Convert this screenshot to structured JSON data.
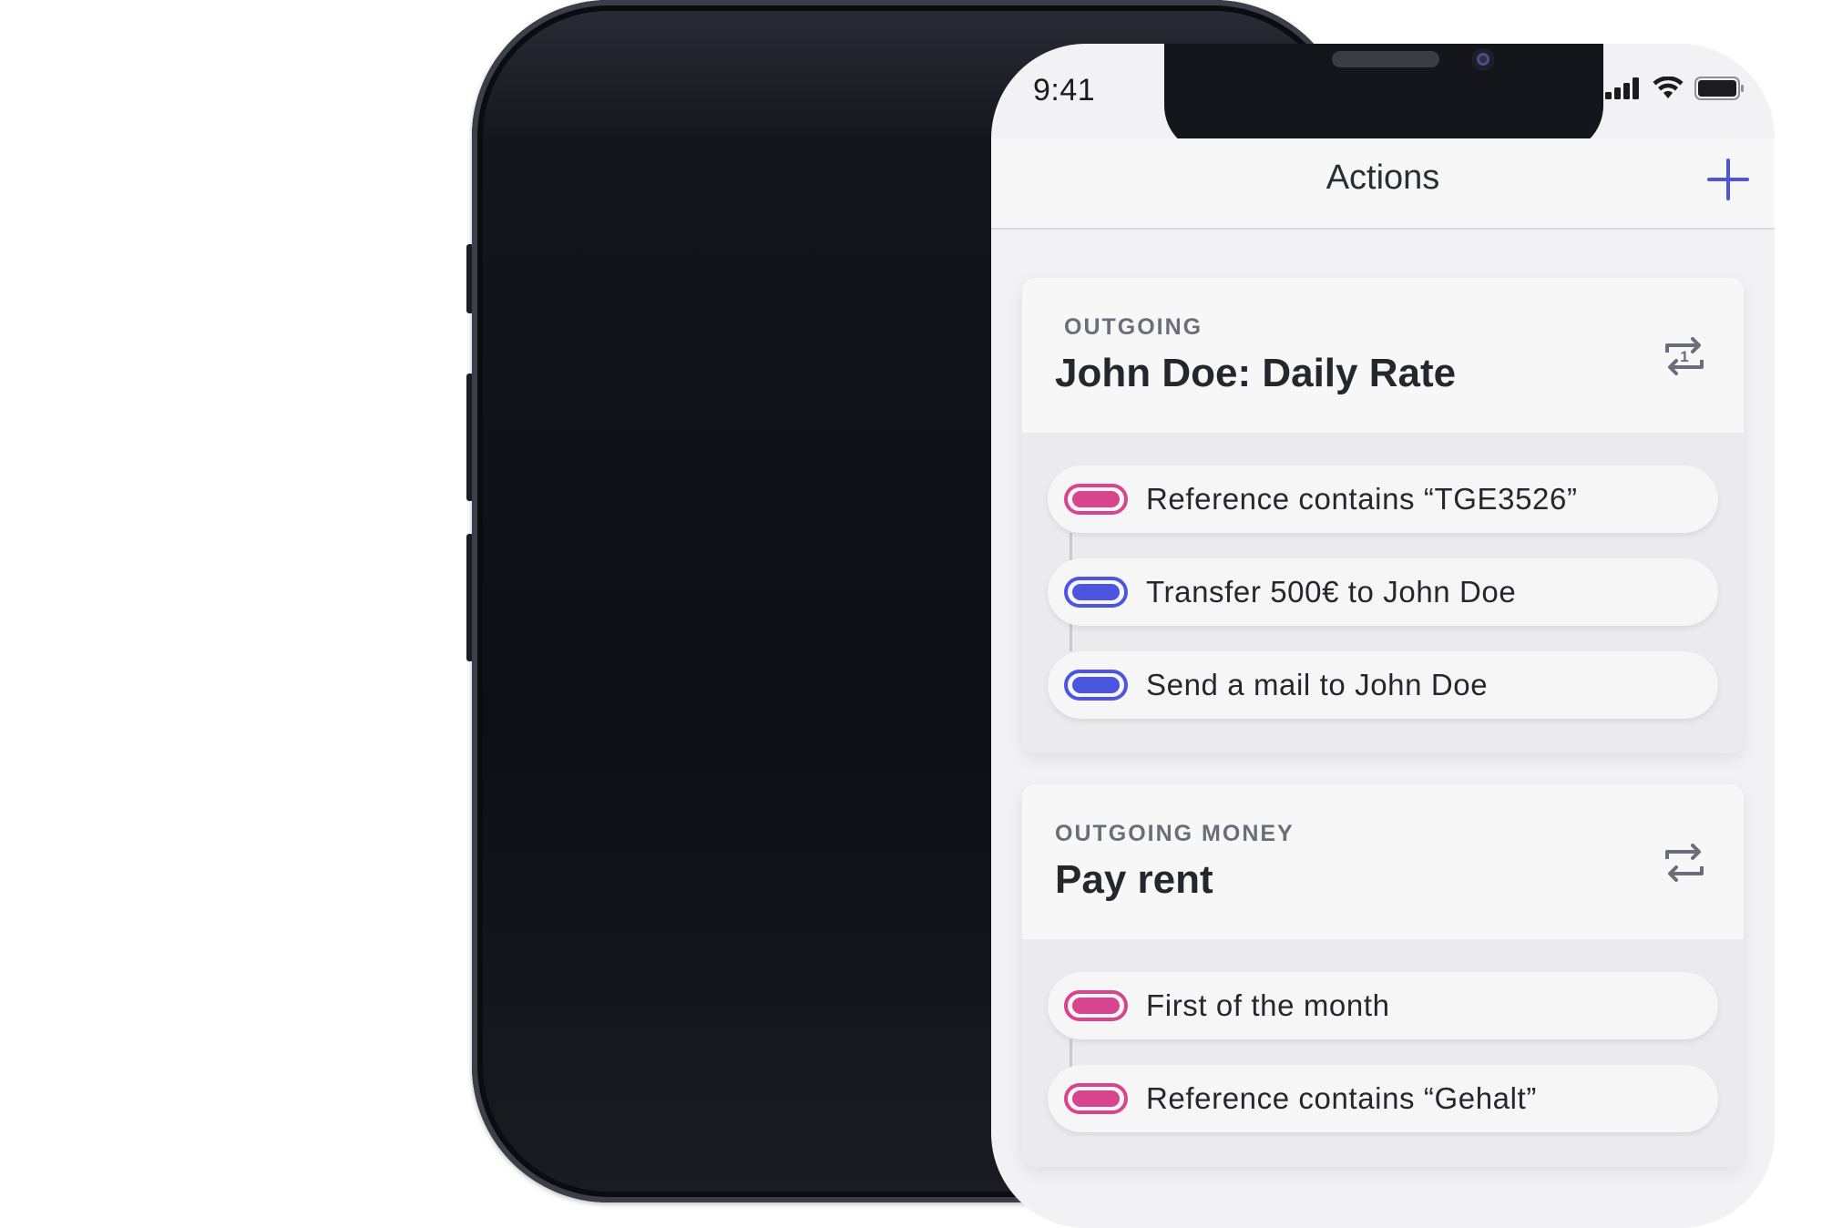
{
  "status_bar": {
    "time": "9:41"
  },
  "navbar": {
    "title": "Actions"
  },
  "cards": [
    {
      "category": "OUTGOING",
      "title": "John Doe: Daily Rate",
      "repeat_icon": "repeat-once-icon",
      "steps": [
        {
          "kind": "trigger",
          "label": "Reference contains “TGE3526”"
        },
        {
          "kind": "action",
          "label": "Transfer 500€ to John Doe"
        },
        {
          "kind": "action",
          "label": "Send a mail to John Doe"
        }
      ]
    },
    {
      "category": "OUTGOING MONEY",
      "title": "Pay rent",
      "repeat_icon": "repeat-icon",
      "steps": [
        {
          "kind": "trigger",
          "label": "First of the month"
        },
        {
          "kind": "trigger",
          "label": "Reference contains “Gehalt”"
        }
      ]
    }
  ],
  "colors": {
    "trigger": "#d9448f",
    "action": "#4b55e0",
    "accent": "#4b55e0"
  }
}
